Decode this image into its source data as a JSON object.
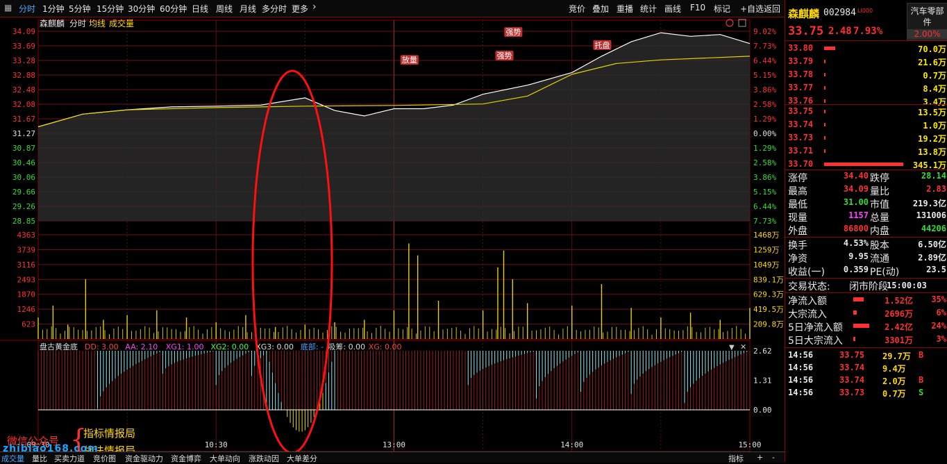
{
  "toolbar": {
    "periods": [
      "分时",
      "1分钟",
      "5分钟",
      "15分钟",
      "30分钟",
      "60分钟",
      "日线",
      "周线",
      "月线",
      "多分时",
      "更多"
    ],
    "right": [
      "竞价",
      "叠加",
      "重播",
      "统计",
      "画线",
      "F10",
      "标记",
      "+自选",
      "返回"
    ]
  },
  "chart": {
    "stock_name": "森麒麟",
    "mode": "分时",
    "legend_avg": "均线",
    "legend_vol": "成交量",
    "indicator_title": "盘古黄金底",
    "indicators": [
      {
        "label": "DD: 3.00",
        "color": "#ff4040"
      },
      {
        "label": "AA: 2.10",
        "color": "#ff40ff"
      },
      {
        "label": "XG1: 1.00",
        "color": "#ff40ff"
      },
      {
        "label": "XG2: 0.00",
        "color": "#40ff40"
      },
      {
        "label": "XG3: 0.00",
        "color": "#dddddd"
      },
      {
        "label": "底部: -",
        "color": "#40a0ff"
      },
      {
        "label": "吸筹: 0.00",
        "color": "#dddddd"
      },
      {
        "label": "XG: 0.00",
        "color": "#ff4040"
      }
    ],
    "annotations": [
      "放量",
      "强势",
      "强势",
      "托盘"
    ],
    "time_labels": [
      "09:30",
      "10:30",
      "13:00",
      "14:00",
      "15:00"
    ],
    "watermark": {
      "line1": "微信公众号",
      "line2": "指标情报局",
      "line3": "战法情报局",
      "url": "zhibiao168.com"
    }
  },
  "chart_data": [
    {
      "type": "line",
      "title": "",
      "prev_close": 31.27,
      "y_ticks": [
        "34.09",
        "33.69",
        "33.28",
        "32.88",
        "32.48",
        "32.08",
        "31.67",
        "31.27",
        "30.87",
        "30.46",
        "30.06",
        "29.66",
        "29.26",
        "28.85"
      ],
      "pct_ticks": [
        "9.02%",
        "7.73%",
        "6.44%",
        "5.15%",
        "3.86%",
        "2.58%",
        "1.29%",
        "0.00%",
        "1.29%",
        "2.58%",
        "3.86%",
        "5.15%",
        "6.44%",
        "7.73%"
      ],
      "ylim": [
        28.85,
        34.09
      ],
      "series": [
        {
          "name": "",
          "x": [
            0,
            15,
            30,
            45,
            60,
            75,
            90,
            100,
            110,
            115,
            120,
            130,
            140,
            150,
            165,
            180,
            190,
            200,
            210,
            220,
            230,
            240
          ],
          "values": [
            31.45,
            31.8,
            31.92,
            32.0,
            32.02,
            32.05,
            32.25,
            31.9,
            31.75,
            31.85,
            31.95,
            31.95,
            32.05,
            32.35,
            32.6,
            32.95,
            33.4,
            33.8,
            34.05,
            33.95,
            34.0,
            33.75
          ]
        },
        {
          "name": "",
          "x": [
            0,
            15,
            30,
            60,
            90,
            120,
            150,
            165,
            180,
            195,
            210,
            240
          ],
          "values": [
            31.45,
            31.8,
            31.92,
            31.98,
            32.02,
            32.04,
            32.08,
            32.3,
            32.9,
            33.2,
            33.3,
            33.4
          ]
        }
      ]
    },
    {
      "type": "bar",
      "title": "",
      "y_ticks": [
        "4363",
        "3739",
        "3116",
        "2493",
        "1870",
        "1246",
        "623"
      ],
      "right_ticks": [
        "1468万",
        "1259万",
        "1049万",
        "839.1万",
        "629.3万",
        "419.5万",
        "209.8万"
      ],
      "ylim": [
        0,
        4363
      ],
      "bars": [
        {
          "t": 0,
          "v": 900
        },
        {
          "t": 5,
          "v": 1400
        },
        {
          "t": 10,
          "v": 600
        },
        {
          "t": 16,
          "v": 2500
        },
        {
          "t": 22,
          "v": 800
        },
        {
          "t": 30,
          "v": 1000
        },
        {
          "t": 40,
          "v": 1200
        },
        {
          "t": 50,
          "v": 900
        },
        {
          "t": 60,
          "v": 700
        },
        {
          "t": 70,
          "v": 1000
        },
        {
          "t": 80,
          "v": 500
        },
        {
          "t": 90,
          "v": 600
        },
        {
          "t": 100,
          "v": 700
        },
        {
          "t": 110,
          "v": 800
        },
        {
          "t": 120,
          "v": 1200
        },
        {
          "t": 125,
          "v": 4000
        },
        {
          "t": 128,
          "v": 3500
        },
        {
          "t": 135,
          "v": 1600
        },
        {
          "t": 150,
          "v": 1200
        },
        {
          "t": 155,
          "v": 3000
        },
        {
          "t": 157,
          "v": 3700
        },
        {
          "t": 160,
          "v": 2500
        },
        {
          "t": 165,
          "v": 1500
        },
        {
          "t": 180,
          "v": 1400
        },
        {
          "t": 190,
          "v": 2300
        },
        {
          "t": 200,
          "v": 1300
        },
        {
          "t": 210,
          "v": 900
        },
        {
          "t": 220,
          "v": 1100
        },
        {
          "t": 230,
          "v": 800
        },
        {
          "t": 240,
          "v": 1300
        }
      ]
    },
    {
      "type": "bar",
      "title": "",
      "y_ticks": [
        "2.62",
        "1.31",
        "0.00"
      ],
      "ylim": [
        -1.05,
        2.62
      ]
    }
  ],
  "right": {
    "name": "森麒麟",
    "code": "002984",
    "sector": "汽车零部件",
    "price": "33.75",
    "change": "2.48",
    "change_pct": "7.93%",
    "sector_pct": "2.00%",
    "asks": [
      {
        "p": "33.80",
        "v": "70.0万",
        "w": 0.2
      },
      {
        "p": "33.79",
        "v": "21.6万",
        "w": 0.02
      },
      {
        "p": "33.78",
        "v": "0.7万",
        "w": 0.02
      },
      {
        "p": "33.77",
        "v": "8.4万",
        "w": 0.02
      },
      {
        "p": "33.76",
        "v": "3.4万",
        "w": 0.02
      }
    ],
    "bids": [
      {
        "p": "33.75",
        "v": "13.5万",
        "w": 0.02
      },
      {
        "p": "33.74",
        "v": "1.0万",
        "w": 0.02
      },
      {
        "p": "33.73",
        "v": "19.2万",
        "w": 0.02
      },
      {
        "p": "33.71",
        "v": "13.8万",
        "w": 0.02
      },
      {
        "p": "33.70",
        "v": "345.1万",
        "w": 0.95
      }
    ],
    "stats": [
      {
        "l1": "涨停",
        "v1": "34.40",
        "c1": "#ff3030",
        "l2": "跌停",
        "v2": "28.14",
        "c2": "#33dd33"
      },
      {
        "l1": "最高",
        "v1": "34.09",
        "c1": "#ff3030",
        "l2": "量比",
        "v2": "2.83",
        "c2": "#ff3030"
      },
      {
        "l1": "最低",
        "v1": "31.00",
        "c1": "#33dd33",
        "l2": "市值",
        "v2": "219.3亿",
        "c2": "#e8e8e8"
      },
      {
        "l1": "现量",
        "v1": "1157",
        "c1": "#ff40ff",
        "l2": "总量",
        "v2": "131006",
        "c2": "#e8e8e8"
      },
      {
        "l1": "外盘",
        "v1": "86800",
        "c1": "#ff3030",
        "l2": "内盘",
        "v2": "44206",
        "c2": "#33dd33"
      }
    ],
    "stats2": [
      {
        "l1": "换手",
        "v1": "4.53%",
        "c1": "#e8e8e8",
        "l2": "股本",
        "v2": "6.50亿",
        "c2": "#e8e8e8"
      },
      {
        "l1": "净资",
        "v1": "9.95",
        "c1": "#e8e8e8",
        "l2": "流通",
        "v2": "2.89亿",
        "c2": "#e8e8e8"
      },
      {
        "l1": "收益(一)",
        "v1": "0.359",
        "c1": "#e8e8e8",
        "l2": "PE(动)",
        "v2": "23.5",
        "c2": "#e8e8e8"
      }
    ],
    "status_label": "交易状态:",
    "status_value": "闭市阶段",
    "status_time": "15:00:03",
    "flows": [
      {
        "l": "净流入额",
        "v": "1.52亿",
        "p": "35%",
        "w": 0.3
      },
      {
        "l": "大宗流入",
        "v": "2696万",
        "p": "6%",
        "w": 0.1
      },
      {
        "l": "5日净流入额",
        "v": "2.42亿",
        "p": "24%",
        "w": 0.45
      },
      {
        "l": "5日大宗流入",
        "v": "3301万",
        "p": "3%",
        "w": 0.06
      }
    ],
    "trades": [
      {
        "t": "14:56",
        "p": "33.75",
        "v": "29.7万",
        "s": "B",
        "sc": "#ff3030"
      },
      {
        "t": "14:56",
        "p": "33.74",
        "v": "9.4万",
        "s": "",
        "sc": "#ff3030"
      },
      {
        "t": "14:56",
        "p": "33.74",
        "v": "2.0万",
        "s": "B",
        "sc": "#ff3030"
      },
      {
        "t": "14:56",
        "p": "33.73",
        "v": "0.7万",
        "s": "S",
        "sc": "#33dd33"
      }
    ]
  },
  "bottom": {
    "tabs": [
      "成交量",
      "量比",
      "买卖力道",
      "竞价图",
      "资金驱动力",
      "资金博弈",
      "大单动向",
      "涨跌动因",
      "大单差分"
    ],
    "right": [
      "指标",
      "+",
      "-"
    ]
  }
}
